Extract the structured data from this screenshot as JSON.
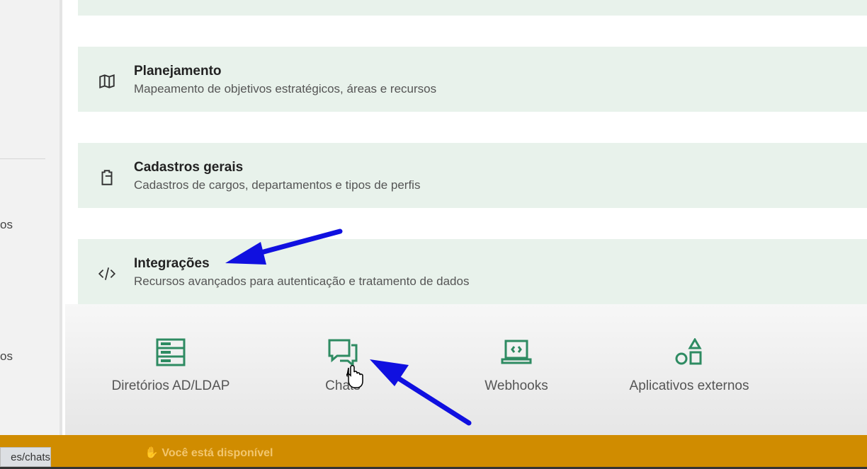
{
  "sidebar": {
    "fragments": [
      "os",
      "os"
    ]
  },
  "cards": [
    {
      "title": "Planejamento",
      "description": "Mapeamento de objetivos estratégicos, áreas e recursos",
      "icon": "map-icon"
    },
    {
      "title": "Cadastros gerais",
      "description": "Cadastros de cargos, departamentos e tipos de perfis",
      "icon": "clipboard-icon"
    },
    {
      "title": "Integrações",
      "description": "Recursos avançados para autenticação e tratamento de dados",
      "icon": "code-icon"
    }
  ],
  "integrations": [
    {
      "label": "Diretórios AD/LDAP",
      "icon": "server-icon"
    },
    {
      "label": "Chats",
      "icon": "chat-icon"
    },
    {
      "label": "Webhooks",
      "icon": "laptop-code-icon"
    },
    {
      "label": "Aplicativos externos",
      "icon": "shapes-icon"
    }
  ],
  "status_bar": {
    "text": "Você está disponível",
    "color": "#d08c00"
  },
  "url_tooltip": "es/chats",
  "accent": "#2e8b62"
}
